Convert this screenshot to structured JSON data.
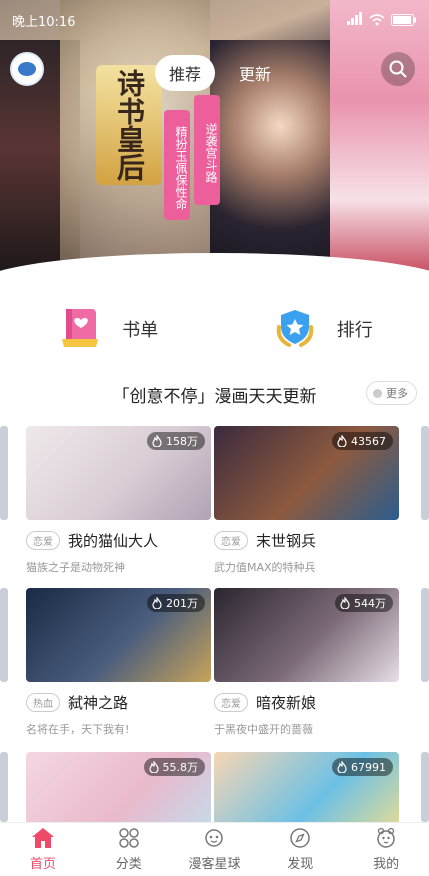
{
  "statusbar": {
    "time": "晚上10:16"
  },
  "header": {
    "tabs": [
      {
        "label": "推荐",
        "active": true
      },
      {
        "label": "更新",
        "active": false
      }
    ]
  },
  "banner": {
    "art_title": "诗书皇后",
    "tags": [
      "逆袭宫斗路",
      "精扮玉佩保性命"
    ]
  },
  "quick": [
    {
      "label": "书单",
      "icon": "booklist-icon"
    },
    {
      "label": "排行",
      "icon": "ranking-badge-icon"
    }
  ],
  "section": {
    "title": "「创意不停」漫画天天更新",
    "more": "更多"
  },
  "comics": [
    {
      "name": "我的猫仙大人",
      "tag": "恋爱",
      "heat": "158万",
      "desc": "猫族之子是动物死神",
      "colors": [
        "#efe9ea",
        "#d9cdd6",
        "#b0a3b3"
      ]
    },
    {
      "name": "末世钢兵",
      "tag": "恋爱",
      "heat": "43567",
      "desc": "武力值MAX的特种兵",
      "colors": [
        "#3b2a3e",
        "#8d5a3f",
        "#2b5d8e"
      ]
    },
    {
      "name": "弑神之路",
      "tag": "热血",
      "heat": "201万",
      "desc": "名将在手，天下我有!",
      "colors": [
        "#1a2a45",
        "#4a5d7d",
        "#c8a35a"
      ]
    },
    {
      "name": "暗夜新娘",
      "tag": "恋爱",
      "heat": "544万",
      "desc": "于黑夜中盛开的蔷薇",
      "colors": [
        "#2b2630",
        "#7c6a78",
        "#e7dfe7"
      ]
    },
    {
      "name": "",
      "tag": "",
      "heat": "55.8万",
      "desc": "",
      "colors": [
        "#f4d7e2",
        "#e9b9cc",
        "#bfe0ef"
      ]
    },
    {
      "name": "",
      "tag": "",
      "heat": "67991",
      "desc": "",
      "colors": [
        "#f7d6b4",
        "#6cc0e5",
        "#f6e08a"
      ]
    }
  ],
  "bottom_nav": [
    {
      "label": "首页",
      "icon": "home-icon",
      "active": true
    },
    {
      "label": "分类",
      "icon": "category-icon",
      "active": false
    },
    {
      "label": "漫客星球",
      "icon": "planet-icon",
      "active": false
    },
    {
      "label": "发现",
      "icon": "compass-icon",
      "active": false
    },
    {
      "label": "我的",
      "icon": "profile-icon",
      "active": false
    }
  ],
  "colors": {
    "accent": "#f04a6a",
    "text": "#222222"
  }
}
